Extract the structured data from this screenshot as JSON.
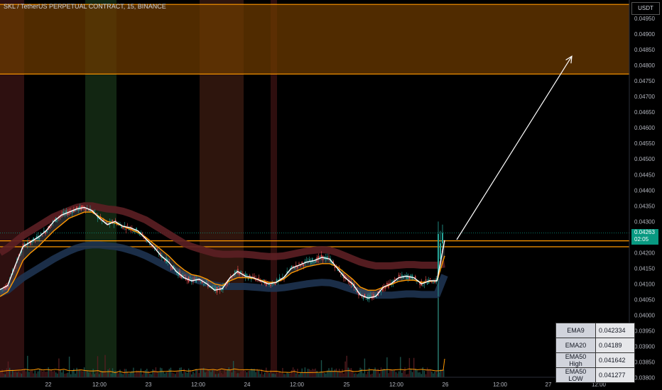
{
  "header": {
    "title": "SKL / TetherUS PERPETUAL CONTRACT, 15, BINANCE",
    "unit": "USDT"
  },
  "price_label": {
    "price": "0.04263",
    "countdown": "02:05"
  },
  "legend": [
    {
      "name": "EMA9",
      "value": "0.042334"
    },
    {
      "name": "EMA20",
      "value": "0.04189"
    },
    {
      "name": "EMA50 High",
      "value": "0.041642"
    },
    {
      "name": "EMA50 LOW",
      "value": "0.041277"
    }
  ],
  "colors": {
    "background": "#000000",
    "up_candle": "#26a69a",
    "down_candle": "#ef5350",
    "zone_fill": "#6b3a00",
    "zone_line": "#ff9800",
    "ema9": "#ffffff",
    "ema20": "#ff9800",
    "ema50_high": "#5c1f24",
    "ema50_low": "#1e3350",
    "price_tag": "#089981"
  },
  "chart_data": {
    "type": "candlestick",
    "title": "SKL / TetherUS PERPETUAL CONTRACT, 15, BINANCE",
    "x_ticks": [
      "22",
      "12:00",
      "23",
      "12:00",
      "24",
      "12:00",
      "25",
      "12:00",
      "26",
      "12:00",
      "27",
      "12:00"
    ],
    "y_ticks": [
      "0.04950",
      "0.04900",
      "0.04850",
      "0.04800",
      "0.04750",
      "0.04700",
      "0.04650",
      "0.04600",
      "0.04550",
      "0.04500",
      "0.04450",
      "0.04400",
      "0.04350",
      "0.04300",
      "0.04250",
      "0.04200",
      "0.04150",
      "0.04100",
      "0.04050",
      "0.04000",
      "0.03950",
      "0.03900",
      "0.03850",
      "0.03800"
    ],
    "y_range": [
      0.0379,
      0.05
    ],
    "resistance_zone": [
      0.04772,
      0.04995
    ],
    "support_zone": [
      0.04219,
      0.04238
    ],
    "last_price": 0.04263,
    "projection_target": 0.04829,
    "ema9": [
      0.04082,
      0.04095,
      0.0416,
      0.0422,
      0.04235,
      0.0425,
      0.0427,
      0.043,
      0.0432,
      0.0433,
      0.0434,
      0.04345,
      0.04335,
      0.0431,
      0.0429,
      0.043,
      0.04285,
      0.0428,
      0.0427,
      0.04245,
      0.0422,
      0.0419,
      0.0417,
      0.0414,
      0.0412,
      0.0411,
      0.04115,
      0.041,
      0.0408,
      0.04085,
      0.0412,
      0.0414,
      0.04125,
      0.0412,
      0.0411,
      0.041,
      0.04105,
      0.0412,
      0.0415,
      0.0416,
      0.0417,
      0.04175,
      0.04185,
      0.0418,
      0.0415,
      0.0412,
      0.041,
      0.04065,
      0.04055,
      0.0406,
      0.0409,
      0.041,
      0.0412,
      0.04125,
      0.0412,
      0.041,
      0.0411,
      0.0411,
      0.0424
    ],
    "ema20": [
      0.0406,
      0.04075,
      0.0412,
      0.04175,
      0.042,
      0.0422,
      0.04245,
      0.0427,
      0.0429,
      0.0431,
      0.0432,
      0.0433,
      0.0433,
      0.04315,
      0.043,
      0.04295,
      0.04285,
      0.04275,
      0.04265,
      0.0425,
      0.0423,
      0.0421,
      0.0419,
      0.04165,
      0.04145,
      0.0413,
      0.04125,
      0.04115,
      0.041,
      0.04095,
      0.0411,
      0.0412,
      0.0412,
      0.04118,
      0.04112,
      0.04105,
      0.04105,
      0.04115,
      0.04135,
      0.04145,
      0.04155,
      0.0416,
      0.04165,
      0.04165,
      0.04155,
      0.04135,
      0.04115,
      0.0409,
      0.0408,
      0.0408,
      0.0409,
      0.04098,
      0.04108,
      0.04112,
      0.04112,
      0.04105,
      0.04108,
      0.0411,
      0.0419
    ],
    "ema50_high": [
      0.042,
      0.04215,
      0.04235,
      0.04255,
      0.0427,
      0.04285,
      0.043,
      0.04315,
      0.04325,
      0.04335,
      0.04345,
      0.0435,
      0.0435,
      0.04345,
      0.0434,
      0.04338,
      0.04333,
      0.04325,
      0.04315,
      0.04305,
      0.0429,
      0.04275,
      0.0426,
      0.04245,
      0.0423,
      0.0422,
      0.04212,
      0.04205,
      0.04198,
      0.04195,
      0.04195,
      0.04196,
      0.04195,
      0.04193,
      0.0419,
      0.04188,
      0.04188,
      0.0419,
      0.04195,
      0.042,
      0.04205,
      0.04208,
      0.0421,
      0.04208,
      0.042,
      0.0419,
      0.0418,
      0.0417,
      0.04163,
      0.04158,
      0.04158,
      0.04158,
      0.0416,
      0.04162,
      0.04162,
      0.0416,
      0.0416,
      0.0416,
      0.04164
    ],
    "ema50_low": [
      0.0407,
      0.0408,
      0.041,
      0.0412,
      0.04135,
      0.0415,
      0.04165,
      0.0418,
      0.04193,
      0.04205,
      0.04215,
      0.04222,
      0.04225,
      0.04225,
      0.04222,
      0.0422,
      0.04215,
      0.04208,
      0.042,
      0.0419,
      0.04178,
      0.04165,
      0.04152,
      0.0414,
      0.04128,
      0.04118,
      0.0411,
      0.04103,
      0.04096,
      0.04092,
      0.04092,
      0.04092,
      0.04092,
      0.0409,
      0.04088,
      0.04086,
      0.04086,
      0.04088,
      0.04092,
      0.04096,
      0.041,
      0.04103,
      0.04105,
      0.04104,
      0.04098,
      0.0409,
      0.04082,
      0.04074,
      0.04068,
      0.04064,
      0.04064,
      0.04064,
      0.04066,
      0.04068,
      0.04068,
      0.04066,
      0.04066,
      0.04066,
      0.04128
    ]
  }
}
